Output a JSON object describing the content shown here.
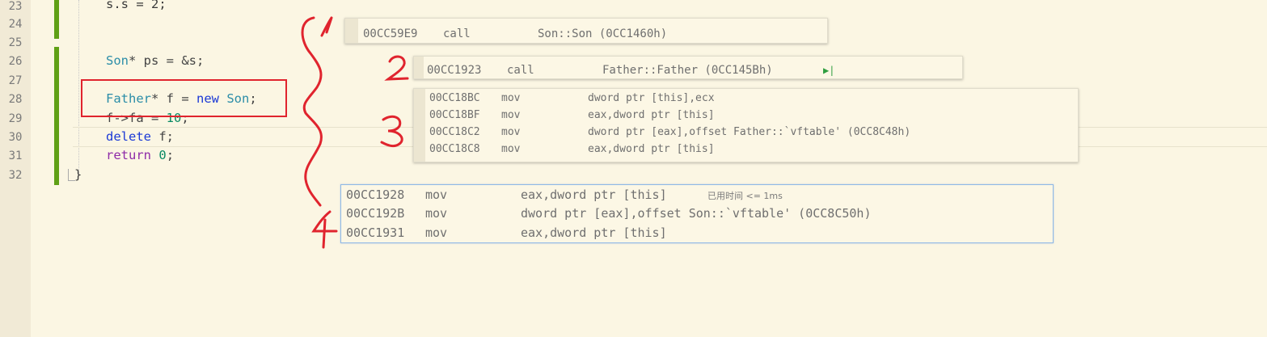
{
  "editor": {
    "line_numbers": [
      "23",
      "24",
      "25",
      "26",
      "27",
      "28",
      "29",
      "30",
      "31",
      "32"
    ],
    "code": {
      "line23": {
        "text": "s.s = 2;"
      },
      "line26": {
        "type": "Son",
        "rest": "* ps = &s;"
      },
      "line28": {
        "type": "Father",
        "mid": "* f = ",
        "kw": "new",
        "type2": "Son",
        "end": ";"
      },
      "line29": {
        "text": "f->fa = ",
        "num": "10",
        "end": ";"
      },
      "line30": {
        "kw": "delete",
        "rest": " f;"
      },
      "line31": {
        "kw": "return",
        "space": " ",
        "num": "0",
        "end": ";"
      },
      "line32": {
        "text": "}"
      }
    }
  },
  "popups": {
    "p1": {
      "rows": [
        {
          "addr": "00CC59E9",
          "op": "call",
          "arg": "Son::Son (0CC1460h)"
        }
      ]
    },
    "p2": {
      "rows": [
        {
          "addr": "00CC1923",
          "op": "call",
          "arg": "Father::Father (0CC145Bh)"
        }
      ],
      "icon": "run-to-cursor-icon",
      "icon_glyph": "▶|"
    },
    "p3": {
      "rows": [
        {
          "addr": "00CC18BC",
          "op": "mov",
          "arg": "dword ptr [this],ecx"
        },
        {
          "addr": "00CC18BF",
          "op": "mov",
          "arg": "eax,dword ptr [this]"
        },
        {
          "addr": "00CC18C2",
          "op": "mov",
          "arg": "dword ptr [eax],offset Father::`vftable' (0CC8C48h)"
        },
        {
          "addr": "00CC18C8",
          "op": "mov",
          "arg": "eax,dword ptr [this]"
        }
      ]
    },
    "p4": {
      "rows": [
        {
          "addr": "00CC1928",
          "op": "mov",
          "arg": "eax,dword ptr [this]"
        },
        {
          "addr": "00CC192B",
          "op": "mov",
          "arg": "dword ptr [eax],offset Son::`vftable' (0CC8C50h)"
        },
        {
          "addr": "00CC1931",
          "op": "mov",
          "arg": "eax,dword ptr [this]"
        }
      ],
      "elapsed": "已用时间 <= 1ms"
    }
  },
  "annotations": {
    "labels": [
      "1",
      "2",
      "3",
      "4"
    ],
    "color": "#e0242e"
  },
  "colors": {
    "background": "#fbf6e3",
    "gutter": "#f1ead6",
    "change_bar": "#5fa015",
    "keyword": "#1b39d6",
    "type": "#2b8da8",
    "number": "#0a8a64",
    "annotation": "#e0242e"
  }
}
